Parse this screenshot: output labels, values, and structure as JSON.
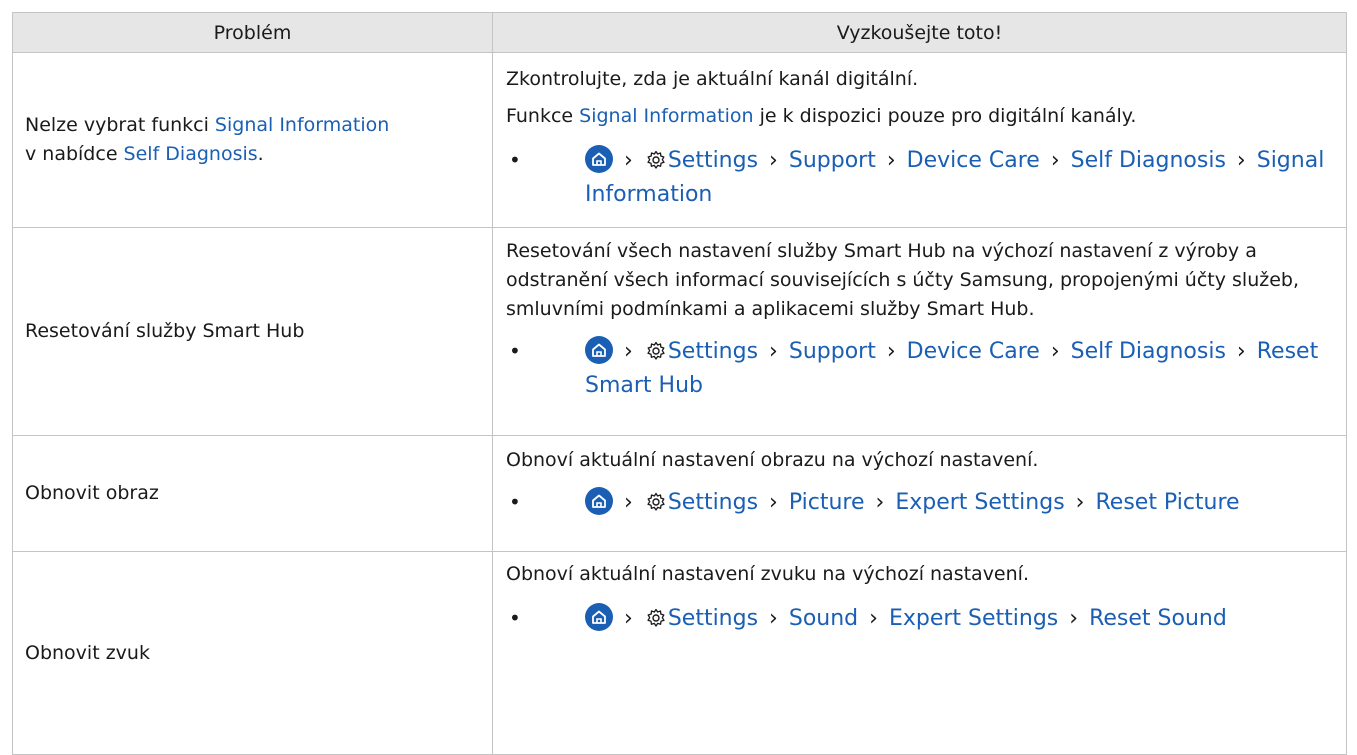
{
  "header": {
    "col1": "Problém",
    "col2": "Vyzkoušejte toto!"
  },
  "rows": [
    {
      "problem": {
        "pre": "Nelze vybrat funkci ",
        "link1": "Signal Information",
        "mid": "v nabídce ",
        "link2": "Self Diagnosis",
        "post": "."
      },
      "line1": "Zkontrolujte, zda je aktuální kanál digitální.",
      "line2_pre": "Funkce ",
      "line2_link": "Signal Information",
      "line2_post": " je k dispozici pouze pro digitální kanály.",
      "path": [
        "Settings",
        "Support",
        "Device Care",
        "Self Diagnosis",
        "Signal Information"
      ]
    },
    {
      "problem": "Resetování služby Smart Hub",
      "text": "Resetování všech nastavení služby Smart Hub na výchozí nastavení z výroby a odstranění všech informací souvisejících s účty Samsung, propojenými účty služeb, smluvními podmínkami a aplikacemi služby Smart Hub.",
      "path": [
        "Settings",
        "Support",
        "Device Care",
        "Self Diagnosis",
        "Reset Smart Hub"
      ]
    },
    {
      "problem": "Obnovit obraz",
      "text": "Obnoví aktuální nastavení obrazu na výchozí nastavení.",
      "path": [
        "Settings",
        "Picture",
        "Expert Settings",
        "Reset Picture"
      ]
    },
    {
      "problem": "Obnovit zvuk",
      "text": "Obnoví aktuální nastavení zvuku na výchozí nastavení.",
      "path": [
        "Settings",
        "Sound",
        "Expert Settings",
        "Reset Sound"
      ]
    }
  ],
  "bullet": "•",
  "separator": "›",
  "icons": {
    "home": "home-icon",
    "settings": "gear-icon"
  },
  "colors": {
    "link": "#1a5fb4",
    "header_bg": "#e6e6e6",
    "border": "#c4c4c4"
  }
}
